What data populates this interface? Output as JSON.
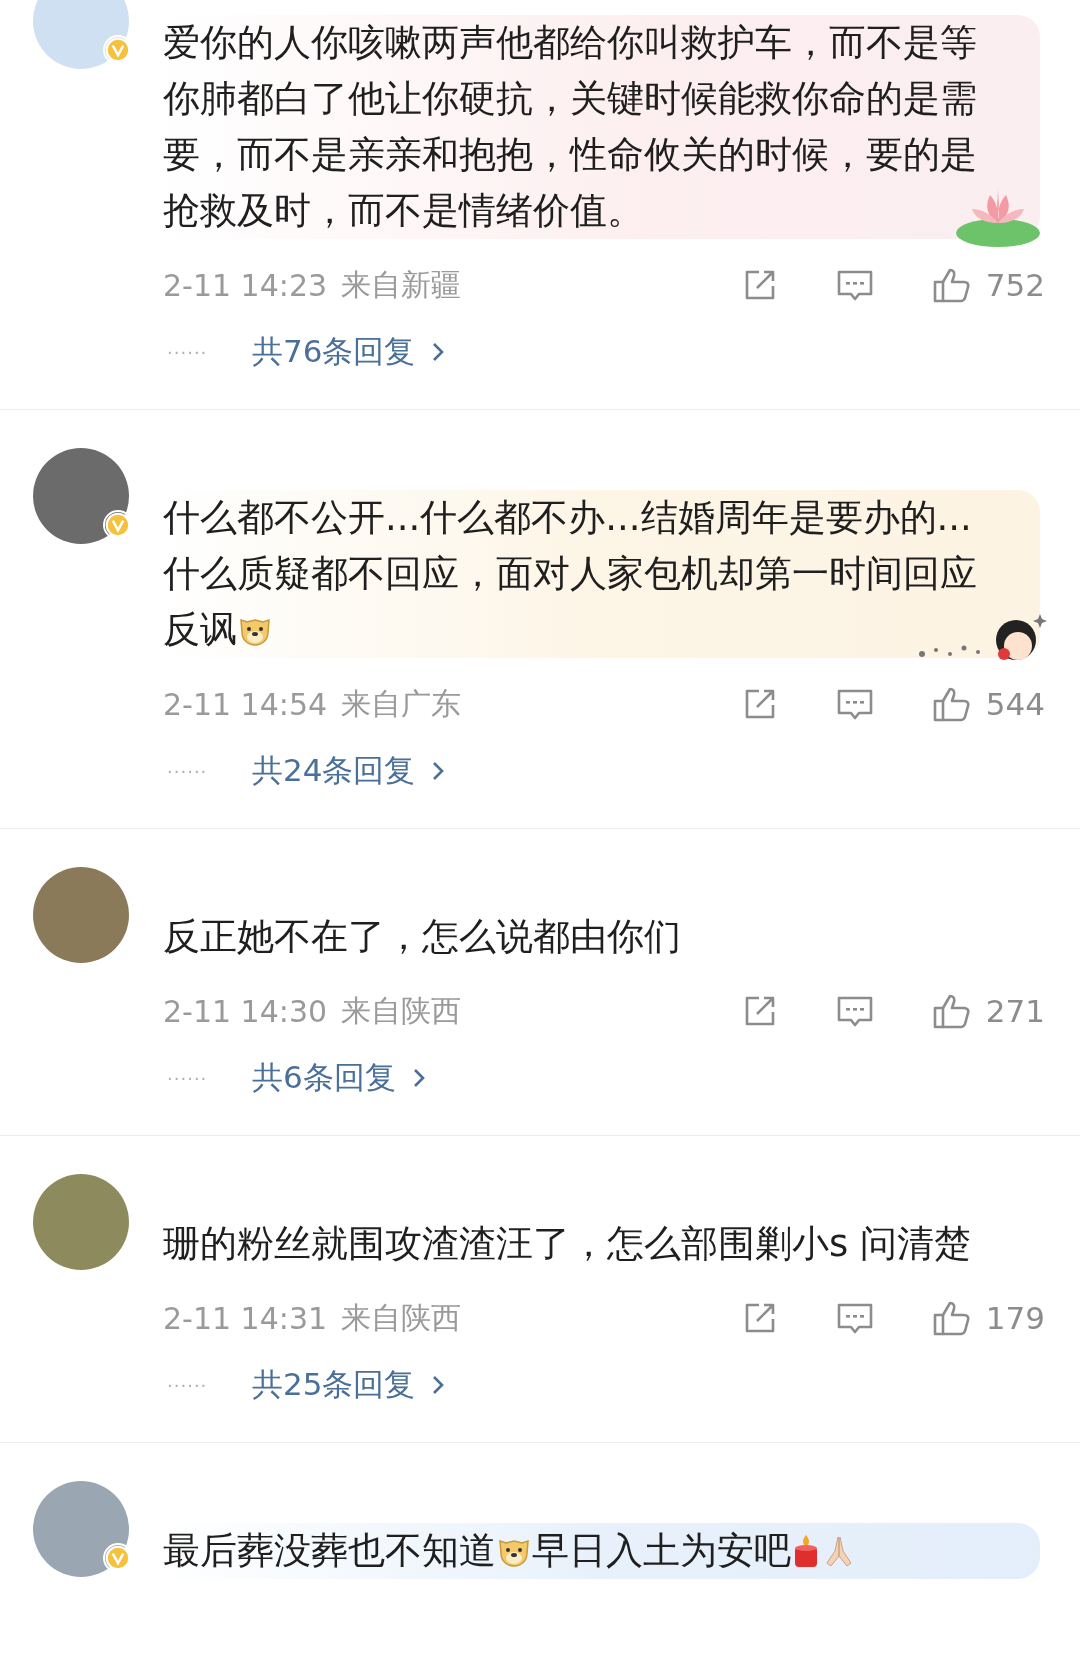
{
  "comments": [
    {
      "verified": true,
      "kind": "pink",
      "content": [
        {
          "kind": "text",
          "text": "爱你的人你咳嗽两声他都给你叫救护车，而不是等你肺都白了他让你硬抗，关键时候能救你命的是需要，而不是亲亲和抱抱，性命攸关的时候，要的是抢救及时，而不是情绪价值。"
        }
      ],
      "time": "2-11 14:23",
      "location": "来自新疆",
      "likes": "752",
      "dots": "······",
      "replies": "共76条回复"
    },
    {
      "verified": true,
      "kind": "cream",
      "content": [
        {
          "kind": "text",
          "text": "什么都不公开...什么都不办...结婚周年是要办的...什么质疑都不回应，面对人家包机却第一时间回应"
        },
        {
          "kind": "text",
          "text": "反讽"
        },
        {
          "kind": "doge"
        }
      ],
      "time": "2-11 14:54",
      "location": "来自广东",
      "likes": "544",
      "dots": "······",
      "replies": "共24条回复"
    },
    {
      "verified": false,
      "kind": "plain",
      "content": [
        {
          "kind": "text",
          "text": "反正她不在了，怎么说都由你们"
        }
      ],
      "time": "2-11 14:30",
      "location": "来自陕西",
      "likes": "271",
      "dots": "······",
      "replies": "共6条回复"
    },
    {
      "verified": false,
      "kind": "plain",
      "content": [
        {
          "kind": "text",
          "text": "珊的粉丝就围攻渣渣汪了，怎么部围剿小s 问清楚"
        }
      ],
      "time": "2-11 14:31",
      "location": "来自陕西",
      "likes": "179",
      "dots": "······",
      "replies": "共25条回复"
    },
    {
      "verified": true,
      "kind": "blue",
      "content": [
        {
          "kind": "text",
          "text": "最后葬没葬也不知道"
        },
        {
          "kind": "doge"
        },
        {
          "kind": "text",
          "text": "早日入土为安吧"
        },
        {
          "kind": "candle"
        },
        {
          "kind": "pray"
        }
      ]
    }
  ]
}
